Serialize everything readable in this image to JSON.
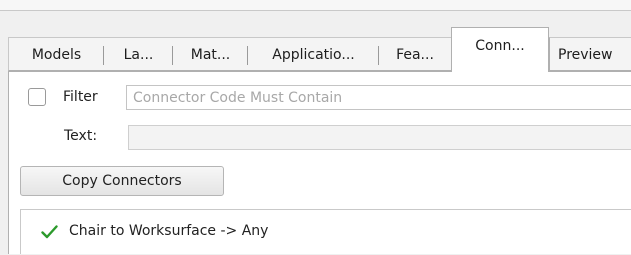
{
  "tabs": [
    {
      "label": "Models",
      "active": false
    },
    {
      "label": "La...",
      "active": false
    },
    {
      "label": "Mat...",
      "active": false
    },
    {
      "label": "Applicatio...",
      "active": false
    },
    {
      "label": "Fea...",
      "active": false
    },
    {
      "label": "Conn...",
      "active": true
    },
    {
      "label": "Preview",
      "active": false
    }
  ],
  "filter": {
    "checkbox_label": "Filter",
    "checked": false,
    "placeholder": "Connector Code Must Contain",
    "value": ""
  },
  "text_field": {
    "label": "Text:",
    "value": ""
  },
  "copy_button": {
    "label": "Copy Connectors"
  },
  "connectors": [
    {
      "label": "Chair to Worksurface -> Any",
      "checked": true,
      "icon": "checkmark-icon"
    }
  ],
  "colors": {
    "checkmark": "#2c9a2c",
    "active_tab_bg": "#ffffff",
    "placeholder": "#a8a8a8"
  }
}
